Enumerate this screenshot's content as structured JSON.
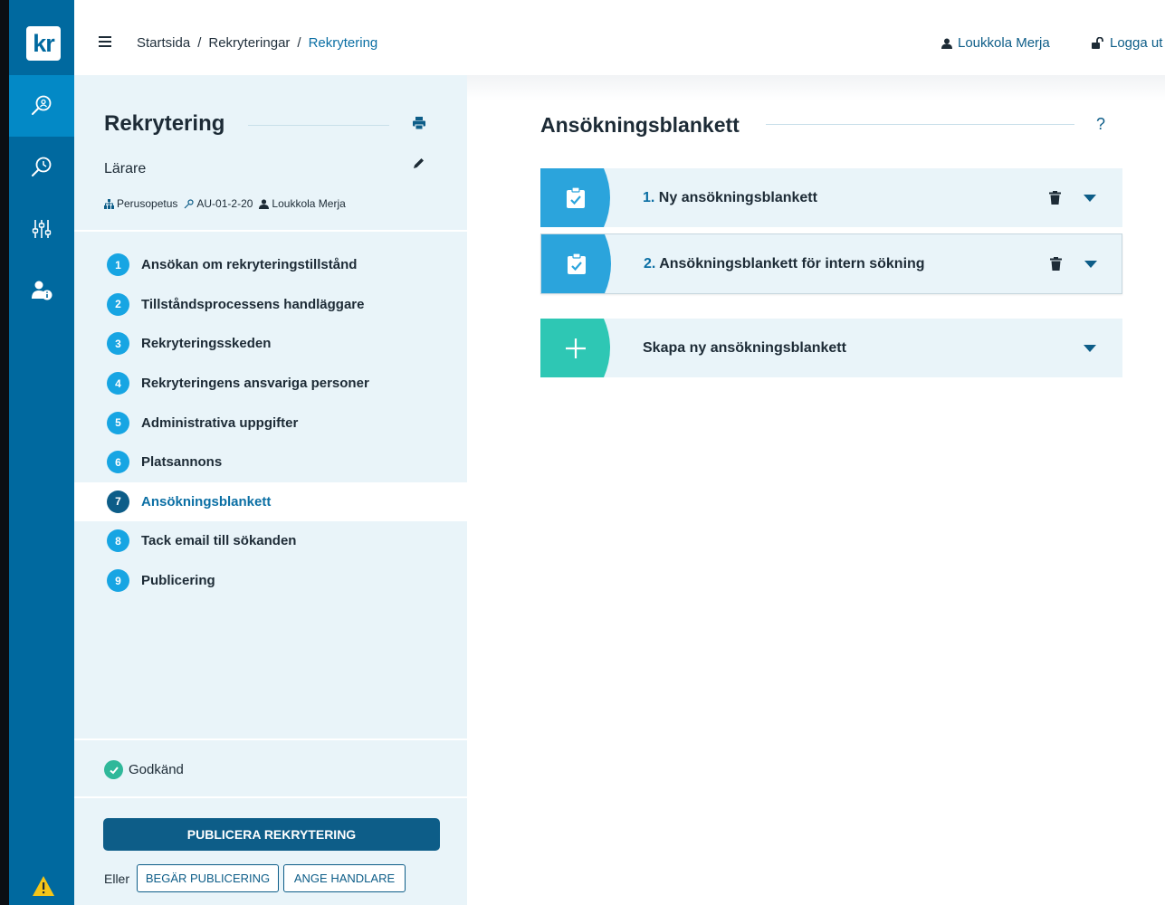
{
  "app": {
    "logo_text": "kr"
  },
  "topbar": {
    "breadcrumbs": [
      "Startsida",
      "Rekryteringar",
      "Rekrytering"
    ],
    "separator": "/",
    "user_name": "Loukkola Merja",
    "logout_label": "Logga ut"
  },
  "sidebar": {
    "title": "Rekrytering",
    "job_title": "Lärare",
    "meta": {
      "unit": "Perusopetus",
      "code": "AU-01-2-20",
      "owner": "Loukkola Merja"
    },
    "steps": [
      {
        "num": "1",
        "label": "Ansökan om rekryteringstillstånd"
      },
      {
        "num": "2",
        "label": "Tillståndsprocessens handläggare"
      },
      {
        "num": "3",
        "label": "Rekryteringsskeden"
      },
      {
        "num": "4",
        "label": "Rekryteringens ansvariga personer"
      },
      {
        "num": "5",
        "label": "Administrativa uppgifter"
      },
      {
        "num": "6",
        "label": "Platsannons"
      },
      {
        "num": "7",
        "label": "Ansökningsblankett"
      },
      {
        "num": "8",
        "label": "Tack email till sökanden"
      },
      {
        "num": "9",
        "label": "Publicering"
      }
    ],
    "active_step": 7,
    "status_label": "Godkänd",
    "publish_label": "PUBLICERA REKRYTERING",
    "or_label": "Eller",
    "request_publish_label": "BEGÄR PUBLICERING",
    "assign_handler_label": "ANGE HANDLARE"
  },
  "main": {
    "title": "Ansökningsblankett",
    "help_label": "?",
    "forms": [
      {
        "num": "1.",
        "label": "Ny ansökningsblankett"
      },
      {
        "num": "2.",
        "label": "Ansökningsblankett för intern sökning"
      }
    ],
    "create_label": "Skapa ny ansökningsblankett"
  },
  "colors": {
    "rail": "#00699f",
    "rail_active": "#0389c6",
    "panel_bg": "#e9f4f9",
    "primary": "#0d5d88",
    "step_badge": "#17a5e3",
    "form_icon": "#2ba4dc",
    "create_icon": "#2ec7b4",
    "success": "#2fb89a"
  }
}
